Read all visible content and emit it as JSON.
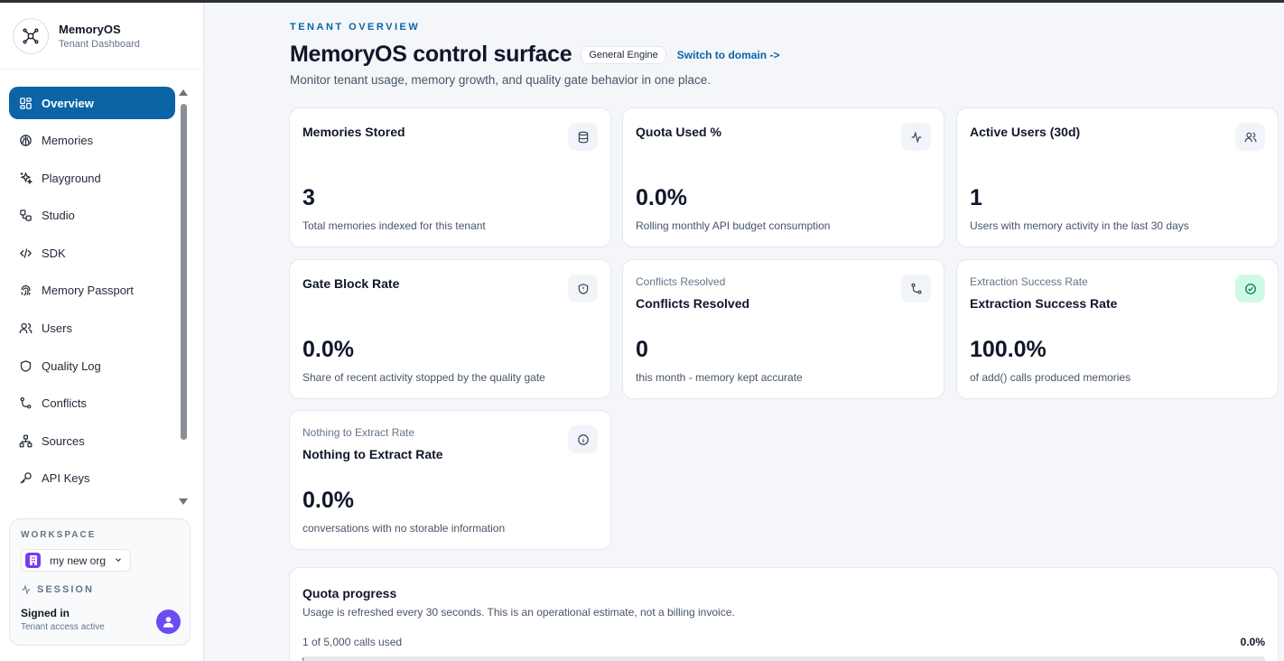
{
  "brand": {
    "name": "MemoryOS",
    "subtitle": "Tenant Dashboard"
  },
  "sidebar": {
    "items": [
      {
        "label": "Overview",
        "icon": "grid-icon",
        "active": true
      },
      {
        "label": "Memories",
        "icon": "brain-icon"
      },
      {
        "label": "Playground",
        "icon": "sparkles-icon"
      },
      {
        "label": "Studio",
        "icon": "workflow-icon"
      },
      {
        "label": "SDK",
        "icon": "code-icon"
      },
      {
        "label": "Memory Passport",
        "icon": "fingerprint-icon"
      },
      {
        "label": "Users",
        "icon": "users-icon"
      },
      {
        "label": "Quality Log",
        "icon": "shield-icon"
      },
      {
        "label": "Conflicts",
        "icon": "git-merge-icon"
      },
      {
        "label": "Sources",
        "icon": "network-icon"
      },
      {
        "label": "API Keys",
        "icon": "key-icon"
      }
    ]
  },
  "workspace": {
    "label": "WORKSPACE",
    "org": "my new org",
    "session_label": "SESSION",
    "signed_in": "Signed in",
    "signed_sub": "Tenant access active"
  },
  "header": {
    "eyebrow": "TENANT OVERVIEW",
    "title": "MemoryOS control surface",
    "badge": "General Engine",
    "switch_link": "Switch to domain ->",
    "subtitle": "Monitor tenant usage, memory growth, and quality gate behavior in one place."
  },
  "cards": [
    {
      "kicker": "",
      "label": "Memories Stored",
      "value": "3",
      "desc": "Total memories indexed for this tenant",
      "icon": "database-icon"
    },
    {
      "kicker": "",
      "label": "Quota Used %",
      "value": "0.0%",
      "desc": "Rolling monthly API budget consumption",
      "icon": "activity-icon"
    },
    {
      "kicker": "",
      "label": "Active Users (30d)",
      "value": "1",
      "desc": "Users with memory activity in the last 30 days",
      "icon": "users-icon"
    },
    {
      "kicker": "",
      "label": "Gate Block Rate",
      "value": "0.0%",
      "desc": "Share of recent activity stopped by the quality gate",
      "icon": "shield-icon"
    },
    {
      "kicker": "Conflicts Resolved",
      "label": "Conflicts Resolved",
      "value": "0",
      "desc": "this month - memory kept accurate",
      "icon": "git-merge-icon"
    },
    {
      "kicker": "Extraction Success Rate",
      "label": "Extraction Success Rate",
      "value": "100.0%",
      "desc": "of add() calls produced memories",
      "icon": "check-circle-icon"
    },
    {
      "kicker": "Nothing to Extract Rate",
      "label": "Nothing to Extract Rate",
      "value": "0.0%",
      "desc": "conversations with no storable information",
      "icon": "info-icon"
    }
  ],
  "quota": {
    "title": "Quota progress",
    "subtitle": "Usage is refreshed every 30 seconds. This is an operational estimate, not a billing invoice.",
    "used": "1 of 5,000 calls used",
    "percent": "0.0%",
    "fraction": 0.0002
  },
  "colors": {
    "accent": "#0b64a6",
    "success_bg": "#d1fae5",
    "avatar": "#6d4df2",
    "org_badge": "#7c3aed"
  }
}
